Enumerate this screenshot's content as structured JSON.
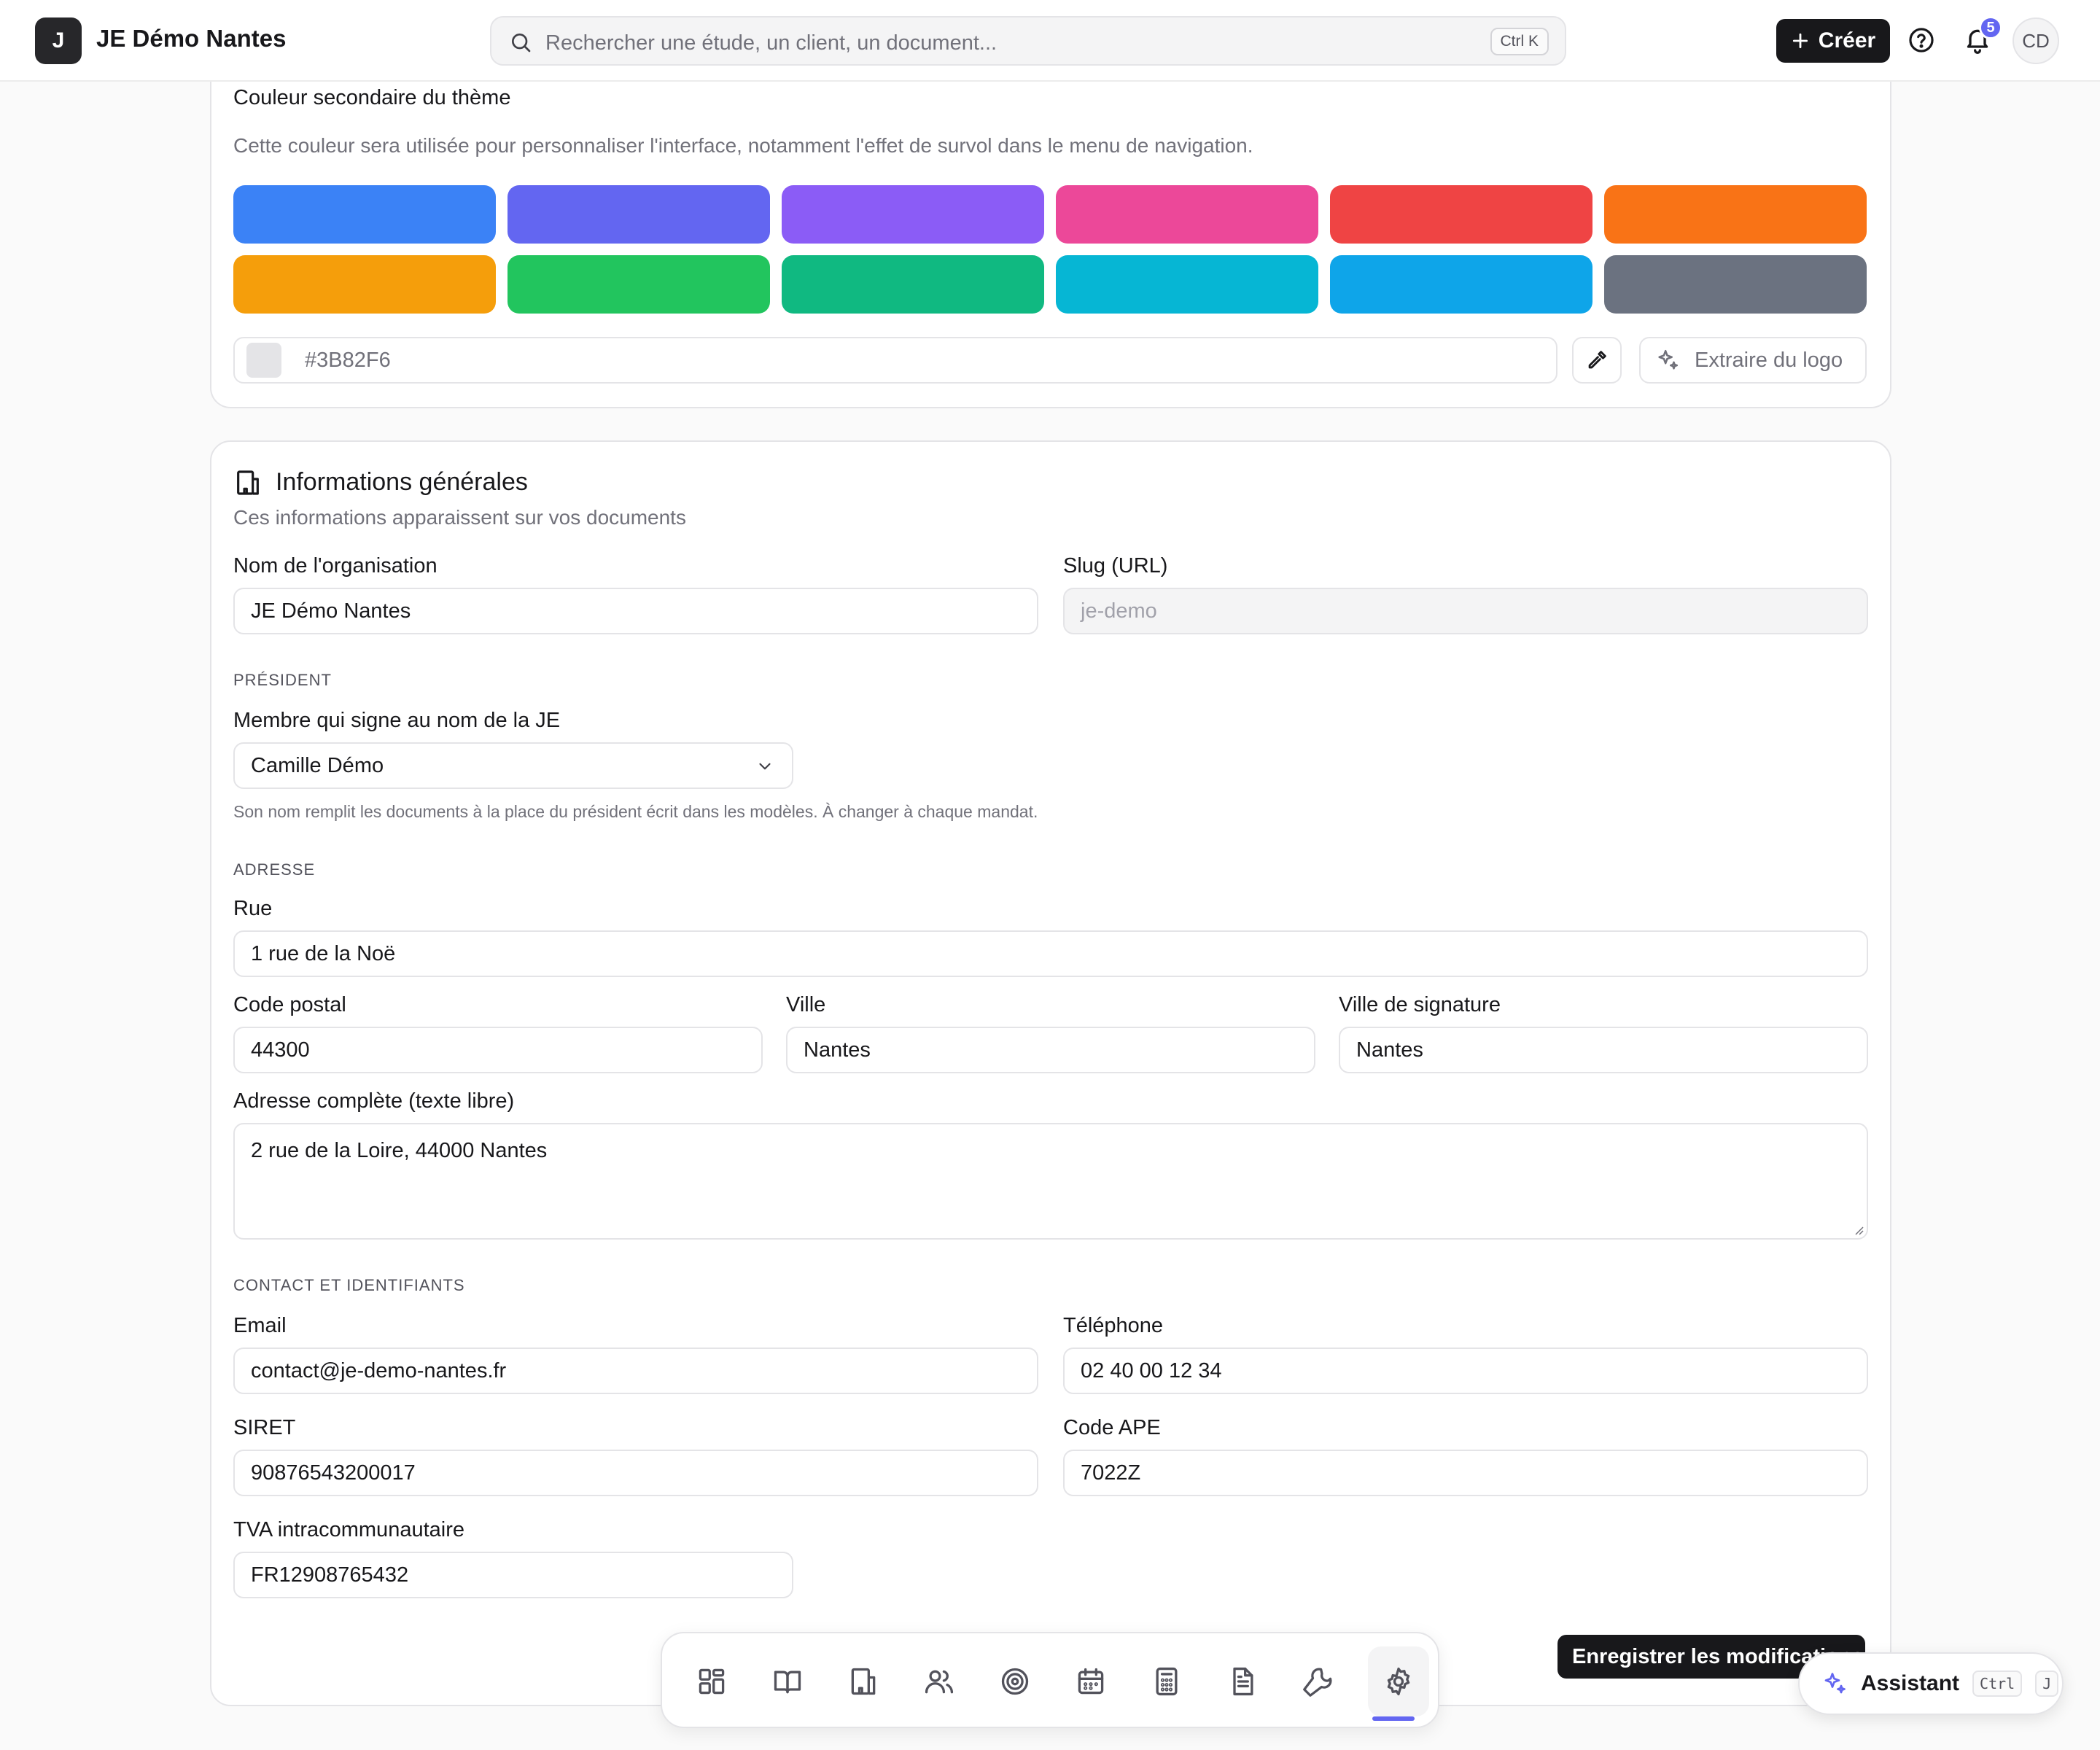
{
  "header": {
    "logo_letter": "J",
    "org_name": "JE Démo Nantes",
    "search_placeholder": "Rechercher une étude, un client, un document...",
    "search_shortcut": "Ctrl K",
    "create_label": "Créer",
    "notification_count": "5",
    "avatar_initials": "CD"
  },
  "theme": {
    "title": "Couleur secondaire du thème",
    "description": "Cette couleur sera utilisée pour personnaliser l'interface, notamment l'effet de survol dans le menu de navigation.",
    "swatches": [
      "#3B82F6",
      "#6366F1",
      "#8B5CF6",
      "#EC4899",
      "#EF4444",
      "#F97316",
      "#F59E0B",
      "#22C55E",
      "#10B981",
      "#06B6D4",
      "#0EA5E9",
      "#6B7280"
    ],
    "hex_placeholder": "#3B82F6",
    "extract_label": "Extraire du logo"
  },
  "general": {
    "title": "Informations générales",
    "subtitle": "Ces informations apparaissent sur vos documents",
    "org_name_label": "Nom de l'organisation",
    "org_name_value": "JE Démo Nantes",
    "slug_label": "Slug (URL)",
    "slug_value": "je-demo",
    "president_caption": "PRÉSIDENT",
    "signer_label": "Membre qui signe au nom de la JE",
    "signer_value": "Camille Démo",
    "signer_help": "Son nom remplit les documents à la place du président écrit dans les modèles. À changer à chaque mandat.",
    "address_caption": "ADRESSE",
    "street_label": "Rue",
    "street_value": "1 rue de la Noë",
    "postal_label": "Code postal",
    "postal_value": "44300",
    "city_label": "Ville",
    "city_value": "Nantes",
    "signature_city_label": "Ville de signature",
    "signature_city_value": "Nantes",
    "full_address_label": "Adresse complète (texte libre)",
    "full_address_value": "2 rue de la Loire, 44000 Nantes",
    "contact_caption": "CONTACT ET IDENTIFIANTS",
    "email_label": "Email",
    "email_value": "contact@je-demo-nantes.fr",
    "phone_label": "Téléphone",
    "phone_value": "02 40 00 12 34",
    "siret_label": "SIRET",
    "siret_value": "90876543200017",
    "ape_label": "Code APE",
    "ape_value": "7022Z",
    "vat_label": "TVA intracommunautaire",
    "vat_value": "FR12908765432",
    "save_label": "Enregistrer les modifications"
  },
  "dock": {
    "items": [
      "dashboard-icon",
      "book-icon",
      "building-icon",
      "users-icon",
      "target-icon",
      "calendar-icon",
      "calculator-icon",
      "document-icon",
      "wrench-icon",
      "settings-icon"
    ],
    "active": "settings-icon"
  },
  "assistant": {
    "label": "Assistant",
    "key1": "Ctrl",
    "key2": "J"
  }
}
